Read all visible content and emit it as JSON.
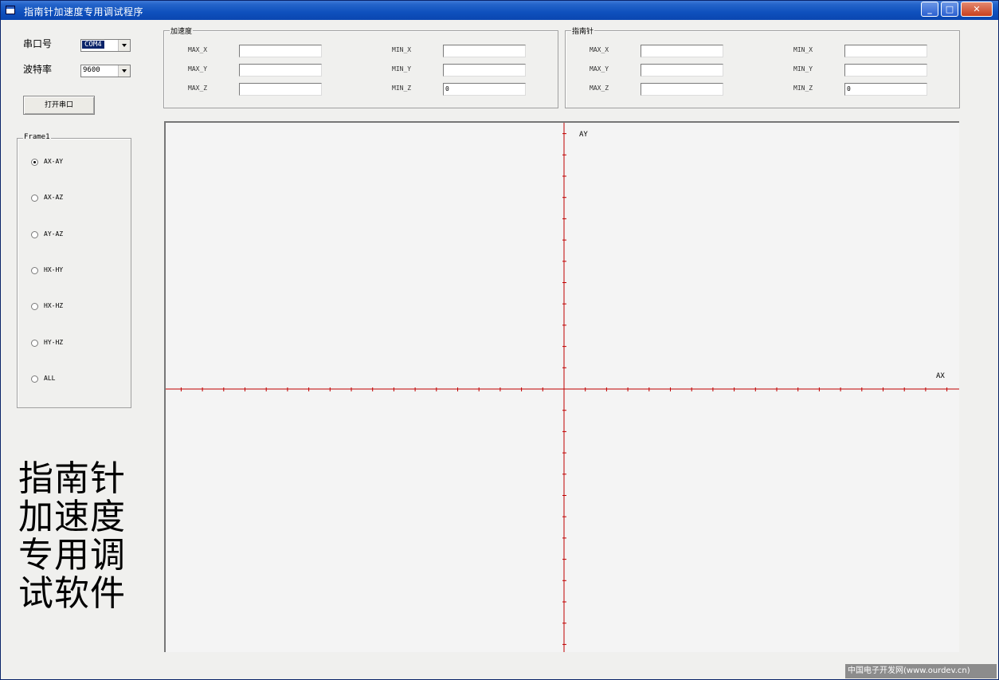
{
  "window": {
    "title": "指南针加速度专用调试程序",
    "buttons": {
      "minimize": "_",
      "maximize": "□",
      "close": "✕"
    }
  },
  "serial": {
    "port_label": "串口号",
    "port_value": "COM4",
    "baud_label": "波特率",
    "baud_value": "9600",
    "open_button": "打开串口"
  },
  "accel_group": {
    "title": "加速度",
    "fields": [
      {
        "label": "MAX_X",
        "value": ""
      },
      {
        "label": "MAX_Y",
        "value": ""
      },
      {
        "label": "MAX_Z",
        "value": ""
      },
      {
        "label": "MIN_X",
        "value": ""
      },
      {
        "label": "MIN_Y",
        "value": ""
      },
      {
        "label": "MIN_Z",
        "value": "0"
      }
    ]
  },
  "compass_group": {
    "title": "指南针",
    "fields": [
      {
        "label": "MAX_X",
        "value": ""
      },
      {
        "label": "MAX_Y",
        "value": ""
      },
      {
        "label": "MAX_Z",
        "value": ""
      },
      {
        "label": "MIN_X",
        "value": ""
      },
      {
        "label": "MIN_Y",
        "value": ""
      },
      {
        "label": "MIN_Z",
        "value": "0"
      }
    ]
  },
  "frame1": {
    "title": "Frame1",
    "options": [
      {
        "label": "AX-AY",
        "selected": true
      },
      {
        "label": "AX-AZ",
        "selected": false
      },
      {
        "label": "AY-AZ",
        "selected": false
      },
      {
        "label": "HX-HY",
        "selected": false
      },
      {
        "label": "HX-HZ",
        "selected": false
      },
      {
        "label": "HY-HZ",
        "selected": false
      },
      {
        "label": "ALL",
        "selected": false
      }
    ]
  },
  "big_text": [
    "指南针",
    "加速度",
    "专用调",
    "试软件"
  ],
  "plot": {
    "x_axis_label": "AX",
    "y_axis_label": "AY",
    "axis_color": "#c00000"
  },
  "watermark": "中国电子开发网(www.ourdev.cn)"
}
